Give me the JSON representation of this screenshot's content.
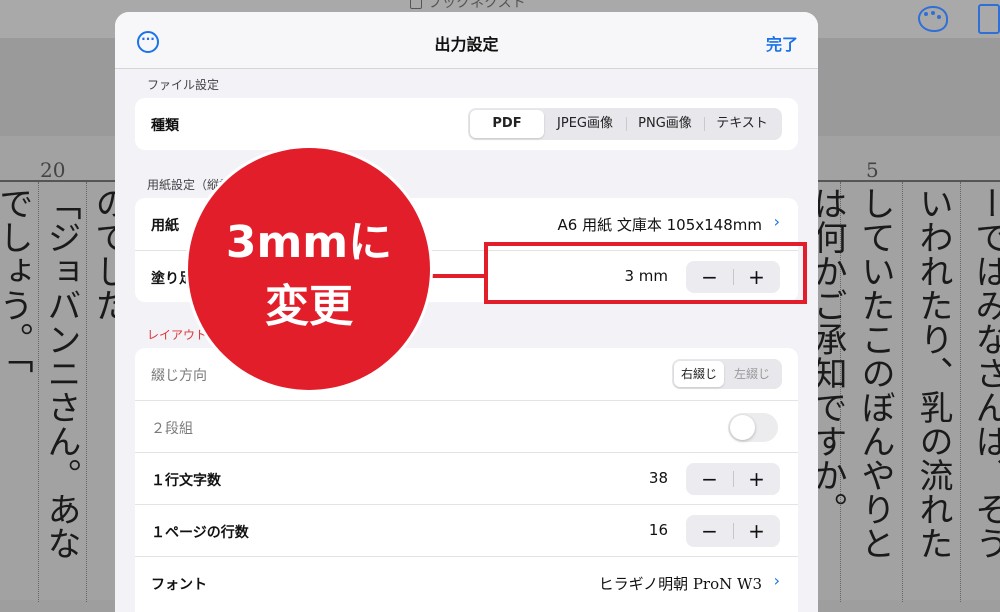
{
  "background": {
    "app_title": "ブックネクスト",
    "column_numbers": [
      "20",
      "5"
    ],
    "columns": [
      {
        "text": "でしょう。「"
      },
      {
        "text": "「ジョバンニさん。あな"
      },
      {
        "text": "のでした"
      },
      {
        "text": "は何かご承知ですか。"
      },
      {
        "text": "していたこのぼんやりと"
      },
      {
        "text": "いわれたり、乳の流れた"
      },
      {
        "text": "ーではみなさんは、そう"
      }
    ]
  },
  "modal": {
    "title": "出力設定",
    "done_label": "完了",
    "sections": {
      "file": {
        "label": "ファイル設定",
        "type_label": "種類",
        "type_options": [
          "PDF",
          "JPEG画像",
          "PNG画像",
          "テキスト"
        ],
        "type_selected": "PDF"
      },
      "paper": {
        "label": "用紙設定（縦書",
        "paper_label": "用紙",
        "paper_value": "A6 用紙 文庫本 105x148mm",
        "bleed_label": "塗り足",
        "bleed_value": "3 mm"
      },
      "layout": {
        "label": "レイアウト",
        "binding_label": "綴じ方向",
        "binding_options": [
          "右綴じ",
          "左綴じ"
        ],
        "binding_selected": "右綴じ",
        "two_column_label": "２段組",
        "chars_per_line_label": "１行文字数",
        "chars_per_line_value": "38",
        "lines_per_page_label": "１ページの行数",
        "lines_per_page_value": "16",
        "font_label": "フォント",
        "font_value": "ヒラギノ明朝 ProN W3"
      }
    },
    "stepper_minus": "−",
    "stepper_plus": "+"
  },
  "annotation": {
    "line1": "3mmに",
    "line2": "変更"
  }
}
